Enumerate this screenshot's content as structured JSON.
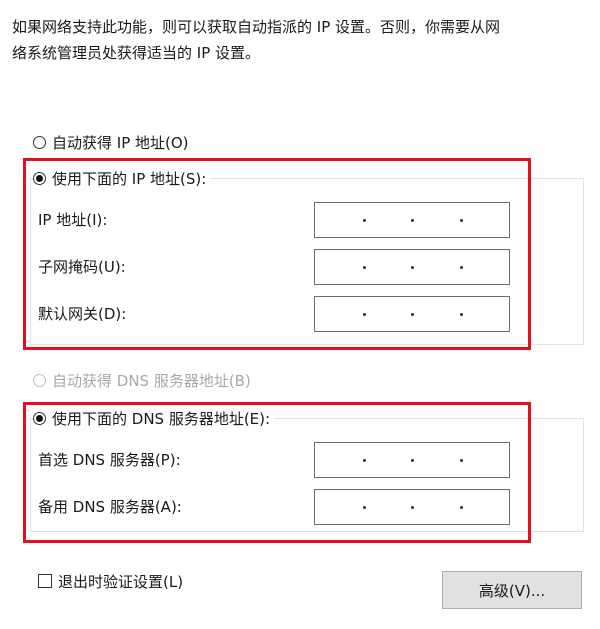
{
  "description": {
    "line1": "如果网络支持此功能，则可以获取自动指派的 IP 设置。否则，你需要从网",
    "line2": "络系统管理员处获得适当的 IP 设置。"
  },
  "ip_section": {
    "auto_option": {
      "label": "自动获得 IP 地址(O)",
      "checked": false
    },
    "manual_option": {
      "label": "使用下面的 IP 地址(S):",
      "checked": true
    },
    "fields": [
      {
        "label": "IP 地址(I):",
        "value": ""
      },
      {
        "label": "子网掩码(U):",
        "value": ""
      },
      {
        "label": "默认网关(D):",
        "value": ""
      }
    ]
  },
  "dns_section": {
    "auto_option": {
      "label": "自动获得 DNS 服务器地址(B)",
      "checked": false,
      "disabled": true
    },
    "manual_option": {
      "label": "使用下面的 DNS 服务器地址(E):",
      "checked": true
    },
    "fields": [
      {
        "label": "首选 DNS 服务器(P):",
        "value": ""
      },
      {
        "label": "备用 DNS 服务器(A):",
        "value": ""
      }
    ]
  },
  "validate_on_exit": {
    "label": "退出时验证设置(L)",
    "checked": false
  },
  "advanced_button": {
    "label": "高级(V)..."
  },
  "colors": {
    "highlight_border": "#e0101e",
    "button_bg": "#e1e1e1"
  }
}
